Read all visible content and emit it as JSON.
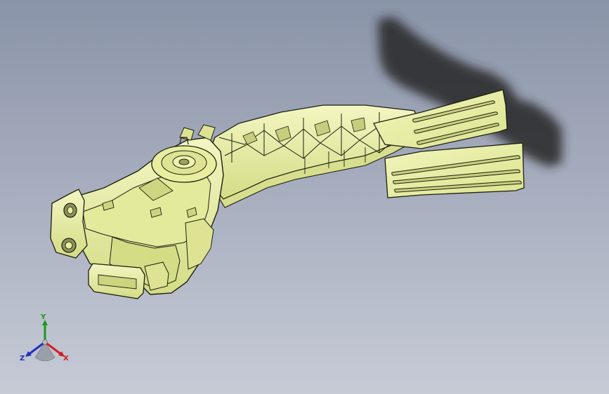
{
  "viewport": {
    "background_top": "#8a94a8",
    "background_bottom": "#c7cbd6"
  },
  "model": {
    "body_color": "#e9efa6",
    "edge_color": "#1e1e10",
    "shadow_color": "#262626"
  },
  "triad": {
    "x_label": "X",
    "y_label": "Y",
    "z_label": "Z",
    "x_color": "#d02020",
    "y_color": "#1a9a1a",
    "z_color": "#2030c0"
  }
}
